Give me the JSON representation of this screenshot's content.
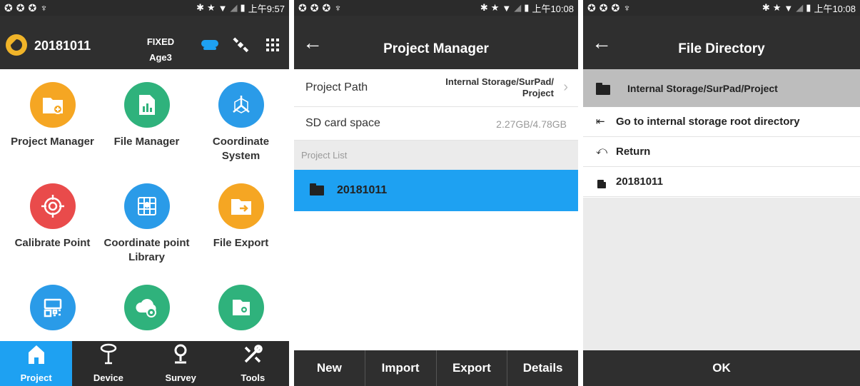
{
  "status": {
    "left_icons": [
      "sync-icon",
      "sync-icon",
      "sync-icon",
      "location-icon"
    ],
    "s1_time": "上午9:57",
    "s2_time": "上午10:08",
    "s3_time": "上午10:08"
  },
  "screen1": {
    "project_name": "20181011",
    "fix_status": "FIXED",
    "age": "Age3",
    "tiles": [
      {
        "label": "Project Manager",
        "color": "#f5a623",
        "icon": "folder-add-icon"
      },
      {
        "label": "File Manager",
        "color": "#2fb27c",
        "icon": "file-chart-icon"
      },
      {
        "label": "Coordinate\nSystem",
        "color": "#2a9be8",
        "icon": "axis-icon"
      },
      {
        "label": "Calibrate Point",
        "color": "#e94b4b",
        "icon": "target-icon"
      },
      {
        "label": "Coordinate point\nLibrary",
        "color": "#2a9be8",
        "icon": "map-grid-icon"
      },
      {
        "label": "File Export",
        "color": "#f5a623",
        "icon": "folder-export-icon"
      },
      {
        "label": "",
        "color": "#2a9be8",
        "icon": "qr-code-icon"
      },
      {
        "label": "",
        "color": "#2fb27c",
        "icon": "cloud-settings-icon"
      },
      {
        "label": "",
        "color": "#2fb27c",
        "icon": "file-settings-icon"
      }
    ],
    "tabs": [
      "Project",
      "Device",
      "Survey",
      "Tools"
    ]
  },
  "screen2": {
    "title": "Project Manager",
    "project_path_label": "Project Path",
    "project_path_value_1": "Internal Storage/SurPad/",
    "project_path_value_2": "Project",
    "sd_label": "SD card space",
    "sd_value": "2.27GB/4.78GB",
    "list_header": "Project List",
    "project_item": "20181011",
    "accent": "#1ea1f2",
    "buttons": [
      "New",
      "Import",
      "Export",
      "Details"
    ]
  },
  "screen3": {
    "title": "File Directory",
    "current_path": "Internal Storage/SurPad/Project",
    "items": [
      "Go to internal storage root directory",
      "Return",
      "20181011"
    ],
    "ok_label": "OK"
  }
}
